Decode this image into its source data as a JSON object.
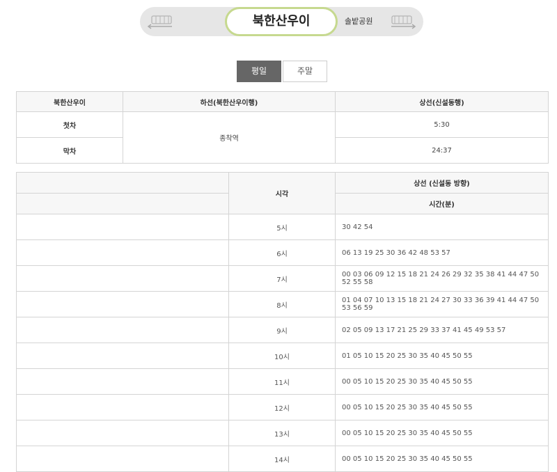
{
  "station_bar": {
    "current_station": "북한산우이",
    "next_station": "솔밭공원"
  },
  "tabs": [
    {
      "label": "평일",
      "active": true
    },
    {
      "label": "주말",
      "active": false
    }
  ],
  "first_last_table": {
    "headers": [
      "북한산우이",
      "하선(북한산우이행)",
      "상선(신설동행)"
    ],
    "rows": [
      {
        "label": "첫차",
        "down": "종착역",
        "up": "5:30"
      },
      {
        "label": "막차",
        "down": "종착역",
        "up": "24:37"
      }
    ]
  },
  "schedule_table": {
    "time_header": "시각",
    "direction_header": "상선 (신설동 방향)",
    "minutes_header": "시간(분)",
    "rows": [
      {
        "hour": "5시",
        "minutes": "30 42 54"
      },
      {
        "hour": "6시",
        "minutes": "06 13 19 25 30 36 42 48 53 57"
      },
      {
        "hour": "7시",
        "minutes": "00 03 06 09 12 15 18 21 24 26 29 32 35 38 41 44 47 50 52 55 58"
      },
      {
        "hour": "8시",
        "minutes": "01 04 07 10 13 15 18 21 24 27 30 33 36 39 41 44 47 50 53 56 59"
      },
      {
        "hour": "9시",
        "minutes": "02 05 09 13 17 21 25 29 33 37 41 45 49 53 57"
      },
      {
        "hour": "10시",
        "minutes": "01 05 10 15 20 25 30 35 40 45 50 55"
      },
      {
        "hour": "11시",
        "minutes": "00 05 10 15 20 25 30 35 40 45 50 55"
      },
      {
        "hour": "12시",
        "minutes": "00 05 10 15 20 25 30 35 40 45 50 55"
      },
      {
        "hour": "13시",
        "minutes": "00 05 10 15 20 25 30 35 40 45 50 55"
      },
      {
        "hour": "14시",
        "minutes": "00 05 10 15 20 25 30 35 40 45 50 55"
      }
    ]
  }
}
